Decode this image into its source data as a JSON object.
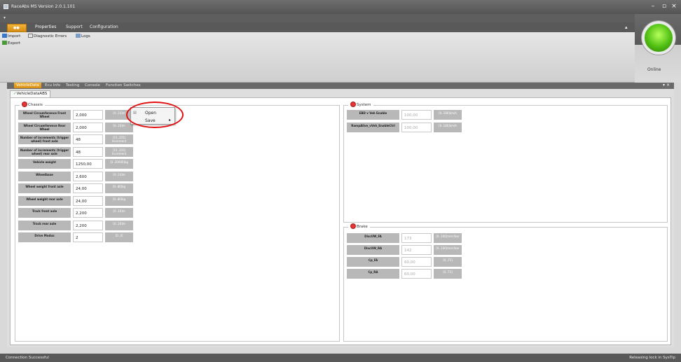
{
  "window": {
    "title": "RaceAbs MS Version 2.0.1.101"
  },
  "ribbon": {
    "tabs": [
      {
        "label": "Properties"
      },
      {
        "label": "Support"
      },
      {
        "label": "Configuration"
      }
    ],
    "buttons": {
      "import": "Import",
      "export": "Export",
      "diagnostic": "Diagnostic Errors",
      "logs": "Logs"
    },
    "online_label": "Online"
  },
  "doc_tabs": [
    "VehicleData",
    "Ecu Info",
    "Testing",
    "Console",
    "Function Switches"
  ],
  "sub_tab": "VehicleDataABS",
  "chassis": {
    "title": "Chassis",
    "rows": [
      {
        "label": "Wheel Circumference Front Wheel",
        "value": "2,000",
        "unit": "[0..10]m"
      },
      {
        "label": "Wheel Circumference Rear Wheel",
        "value": "2,000",
        "unit": "[0..10]m"
      },
      {
        "label": "Number of increments (trigger wheel) front axle",
        "value": "48",
        "unit": "[15..255] Increment"
      },
      {
        "label": "Number of increments (trigger wheel) rear axle",
        "value": "48",
        "unit": "[15..255] Increment"
      },
      {
        "label": "Vehicle weight",
        "value": "1250,00",
        "unit": "[0..20000]kg"
      },
      {
        "label": "Wheelbase",
        "value": "2,600",
        "unit": "[0..10]m"
      },
      {
        "label": "Wheel weight front axle",
        "value": "24,00",
        "unit": "[0..80]kg"
      },
      {
        "label": "Wheel weight rear axle",
        "value": "24,00",
        "unit": "[0..80]kg"
      },
      {
        "label": "Track front axle",
        "value": "2,200",
        "unit": "[0..10]m"
      },
      {
        "label": "Track rear axle",
        "value": "2,200",
        "unit": "[0..10]m"
      },
      {
        "label": "Drive Modus",
        "value": "2",
        "unit": "[0..3]"
      }
    ]
  },
  "system": {
    "title": "System",
    "rows": [
      {
        "label": "EBD v Veh Enable",
        "value": "100,00",
        "unit": "[0..180]km/h"
      },
      {
        "label": "RampAlive_vVeh_EnableCtrl",
        "value": "100,00",
        "unit": "[0..180]km/h"
      }
    ]
  },
  "brake": {
    "title": "Brake",
    "rows": [
      {
        "label": "DiscUW_FA",
        "value": "173",
        "unit": "[0..100]mm²/bar"
      },
      {
        "label": "DiscUW_RA",
        "value": "142",
        "unit": "[0..100]mm²/bar"
      },
      {
        "label": "Cp_FA",
        "value": "60,00",
        "unit": "[0..75]"
      },
      {
        "label": "Cp_RA",
        "value": "60,00",
        "unit": "[0..75]"
      }
    ]
  },
  "context_menu": {
    "items": [
      "Open",
      "Save"
    ]
  },
  "status": {
    "left": "Connection Successful",
    "right": "Releasing lock in SysTip"
  }
}
